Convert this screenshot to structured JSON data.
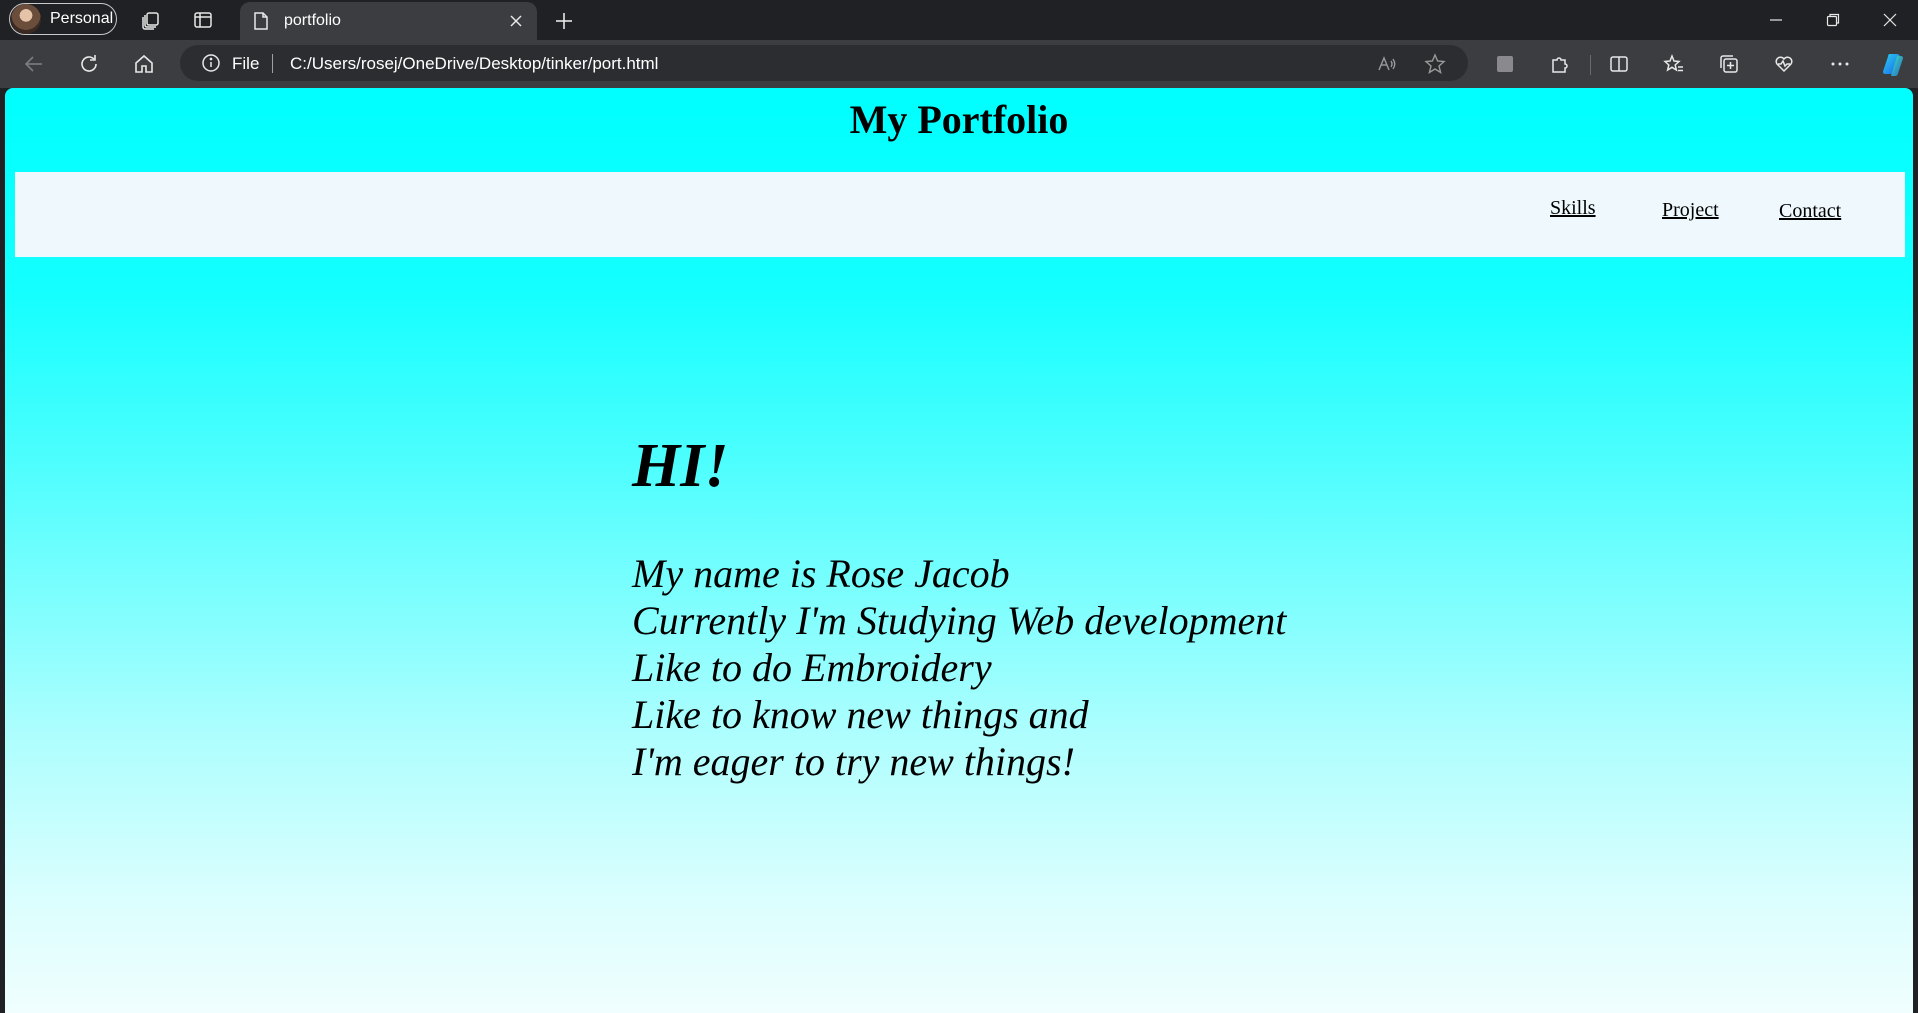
{
  "browser": {
    "profile_label": "Personal",
    "tab_title": "portfolio",
    "address_scheme": "File",
    "url": "C:/Users/rosej/OneDrive/Desktop/tinker/port.html"
  },
  "page": {
    "site_title": "My Portfolio",
    "nav": {
      "skills": "Skills",
      "project": "Project",
      "contact": "Contact"
    },
    "greeting": "HI!",
    "bio_lines": [
      "My name is Rose Jacob",
      "Currently I'm Studying Web development",
      "Like to do Embroidery",
      "Like to know new things and",
      "I'm eager to try new things!"
    ]
  },
  "colors": {
    "page_top": "#00ffff",
    "page_bottom": "#f0fefe",
    "navbar_bg": "#eef8fd",
    "browser_frame": "#202124",
    "toolbar_bg": "#3b3d41"
  },
  "icons": [
    "workspaces-icon",
    "vertical-tabs-icon",
    "page-icon",
    "close-icon",
    "plus-icon",
    "back-icon",
    "refresh-icon",
    "home-icon",
    "info-icon",
    "read-aloud-icon",
    "favorite-star-icon",
    "extension-icon",
    "puzzle-icon",
    "split-screen-icon",
    "favorites-icon",
    "collections-icon",
    "health-icon",
    "more-icon",
    "copilot-icon",
    "minimize-icon",
    "restore-icon",
    "close-window-icon"
  ]
}
